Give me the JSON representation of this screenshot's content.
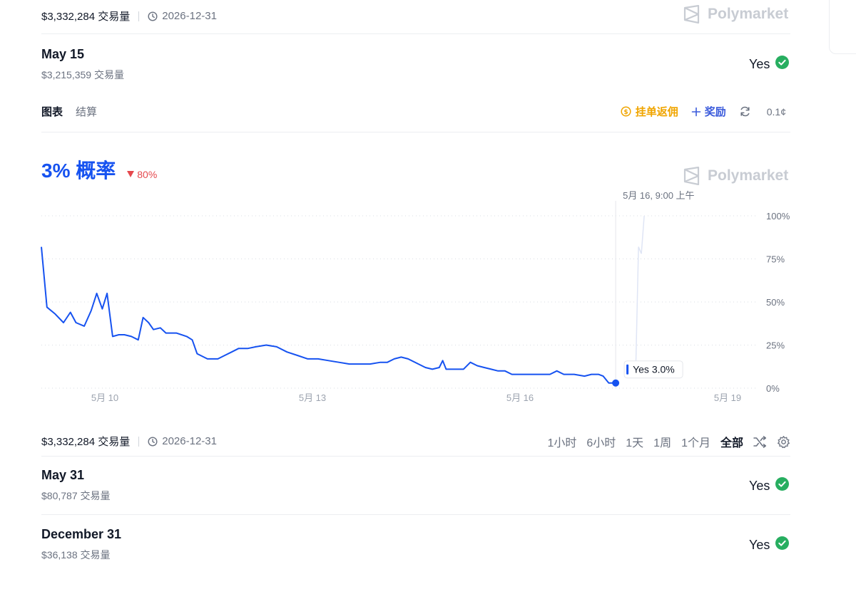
{
  "top_meta": {
    "volume": "$3,332,284 交易量",
    "date": "2026-12-31"
  },
  "brand": {
    "name": "Polymarket"
  },
  "market_top": {
    "title": "May 15",
    "volume": "$3,215,359 交易量",
    "outcome": "Yes"
  },
  "tabs": [
    {
      "label": "图表"
    },
    {
      "label": "结算"
    }
  ],
  "toolbar": {
    "rebate_label": "挂单返佣",
    "reward_label": "奖励",
    "tick_label": "0.1¢"
  },
  "probability": {
    "value": "3% 概率",
    "change": "80%"
  },
  "colors": {
    "accent": "#1652f0",
    "down": "#e5484d",
    "success": "#27ae60",
    "rebate": "#f0a500",
    "reward": "#3b5bdb"
  },
  "chart_data": {
    "type": "line",
    "x_ticks": [
      "5月 10",
      "5月 13",
      "5月 16",
      "5月 19"
    ],
    "y_ticks": [
      "100%",
      "75%",
      "50%",
      "25%",
      "0%"
    ],
    "ylim": [
      0,
      100
    ],
    "grid": true,
    "tooltip": {
      "date": "5月 16, 9:00 上午",
      "label": "Yes 3.0%"
    },
    "series": [
      {
        "color": "#1652f0",
        "points": [
          [
            0,
            82
          ],
          [
            0.08,
            47
          ],
          [
            0.2,
            43
          ],
          [
            0.32,
            38
          ],
          [
            0.42,
            44
          ],
          [
            0.5,
            38
          ],
          [
            0.62,
            36
          ],
          [
            0.72,
            45
          ],
          [
            0.8,
            55
          ],
          [
            0.88,
            46
          ],
          [
            0.95,
            55
          ],
          [
            1.03,
            30
          ],
          [
            1.12,
            31
          ],
          [
            1.2,
            31
          ],
          [
            1.3,
            30
          ],
          [
            1.4,
            28
          ],
          [
            1.47,
            41
          ],
          [
            1.55,
            38
          ],
          [
            1.62,
            34
          ],
          [
            1.72,
            35
          ],
          [
            1.8,
            32
          ],
          [
            1.95,
            32
          ],
          [
            2.1,
            30
          ],
          [
            2.18,
            28
          ],
          [
            2.25,
            20
          ],
          [
            2.4,
            17
          ],
          [
            2.55,
            17
          ],
          [
            2.65,
            19
          ],
          [
            2.75,
            21
          ],
          [
            2.85,
            23
          ],
          [
            2.98,
            23
          ],
          [
            3.1,
            24
          ],
          [
            3.25,
            25
          ],
          [
            3.4,
            24
          ],
          [
            3.55,
            21
          ],
          [
            3.7,
            19
          ],
          [
            3.85,
            17
          ],
          [
            4.0,
            17
          ],
          [
            4.15,
            16
          ],
          [
            4.3,
            15
          ],
          [
            4.45,
            14
          ],
          [
            4.6,
            14
          ],
          [
            4.75,
            14
          ],
          [
            4.9,
            15
          ],
          [
            5.0,
            15
          ],
          [
            5.1,
            17
          ],
          [
            5.2,
            18
          ],
          [
            5.3,
            17
          ],
          [
            5.45,
            14
          ],
          [
            5.55,
            12
          ],
          [
            5.65,
            11
          ],
          [
            5.75,
            12
          ],
          [
            5.8,
            16
          ],
          [
            5.85,
            11
          ],
          [
            5.95,
            11
          ],
          [
            6.1,
            11
          ],
          [
            6.2,
            15
          ],
          [
            6.3,
            13
          ],
          [
            6.4,
            12
          ],
          [
            6.5,
            11
          ],
          [
            6.6,
            10
          ],
          [
            6.7,
            10
          ],
          [
            6.8,
            8
          ],
          [
            6.95,
            8
          ],
          [
            7.1,
            8
          ],
          [
            7.25,
            8
          ],
          [
            7.35,
            8
          ],
          [
            7.45,
            10
          ],
          [
            7.55,
            8
          ],
          [
            7.7,
            8
          ],
          [
            7.85,
            7
          ],
          [
            7.95,
            8
          ],
          [
            8.05,
            8
          ],
          [
            8.12,
            7
          ],
          [
            8.2,
            3
          ],
          [
            8.3,
            3
          ]
        ]
      }
    ]
  },
  "bottom_meta": {
    "volume": "$3,332,284 交易量",
    "date": "2026-12-31"
  },
  "time_ranges": [
    {
      "label": "1小时"
    },
    {
      "label": "6小时"
    },
    {
      "label": "1天"
    },
    {
      "label": "1周"
    },
    {
      "label": "1个月"
    },
    {
      "label": "全部"
    }
  ],
  "markets": [
    {
      "title": "May 31",
      "volume": "$80,787 交易量",
      "outcome": "Yes"
    },
    {
      "title": "December 31",
      "volume": "$36,138 交易量",
      "outcome": "Yes"
    }
  ]
}
